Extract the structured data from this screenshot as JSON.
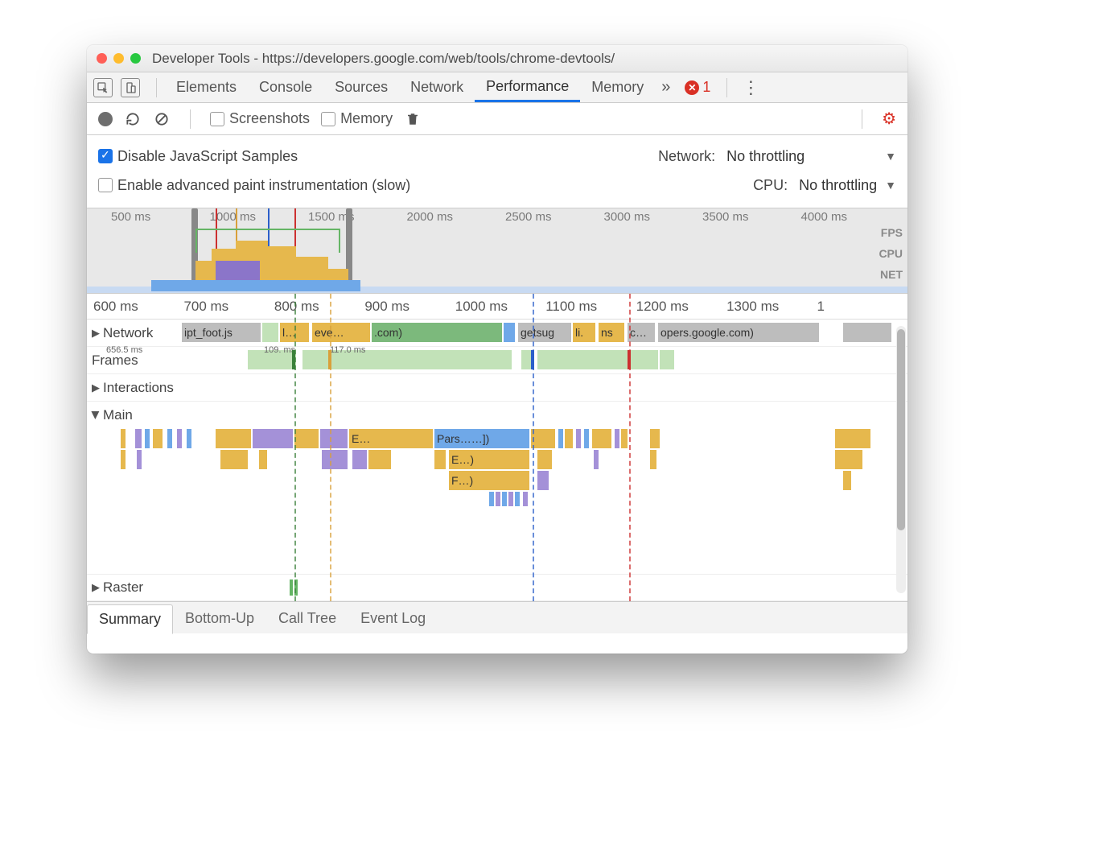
{
  "window": {
    "title": "Developer Tools - https://developers.google.com/web/tools/chrome-devtools/"
  },
  "tabs": {
    "items": [
      "Elements",
      "Console",
      "Sources",
      "Network",
      "Performance",
      "Memory"
    ],
    "active": "Performance",
    "errors": "1"
  },
  "toolbar": {
    "screenshots": "Screenshots",
    "memory": "Memory"
  },
  "settings": {
    "disable_js": "Disable JavaScript Samples",
    "paint_instr": "Enable advanced paint instrumentation (slow)",
    "network_label": "Network:",
    "network_value": "No throttling",
    "cpu_label": "CPU:",
    "cpu_value": "No throttling"
  },
  "overview": {
    "ticks": [
      "500 ms",
      "1000 ms",
      "1500 ms",
      "2000 ms",
      "2500 ms",
      "3000 ms",
      "3500 ms",
      "4000 ms"
    ],
    "labels": [
      "FPS",
      "CPU",
      "NET"
    ]
  },
  "detail": {
    "ticks": [
      "600 ms",
      "700 ms",
      "800 ms",
      "900 ms",
      "1000 ms",
      "1100 ms",
      "1200 ms",
      "1300 ms",
      "1"
    ],
    "rows": {
      "network": "Network",
      "frames": "Frames",
      "interactions": "Interactions",
      "main": "Main",
      "raster": "Raster"
    },
    "frames_labels": {
      "a": "656.5 ms",
      "b": "109. ms",
      "c": "117.0 ms"
    },
    "net_segments": {
      "s1": "ipt_foot.js",
      "s2": "l…",
      "s3": "eve…",
      "s4": ".com)",
      "s5": "getsug",
      "s6": "li.",
      "s7": "ns",
      "s8": "c…",
      "s9": "opers.google.com)"
    },
    "flame": {
      "e": "E…",
      "pars": "Pars……])",
      "e2": "E…)",
      "f": "F…)"
    }
  },
  "bottom_tabs": [
    "Summary",
    "Bottom-Up",
    "Call Tree",
    "Event Log"
  ]
}
